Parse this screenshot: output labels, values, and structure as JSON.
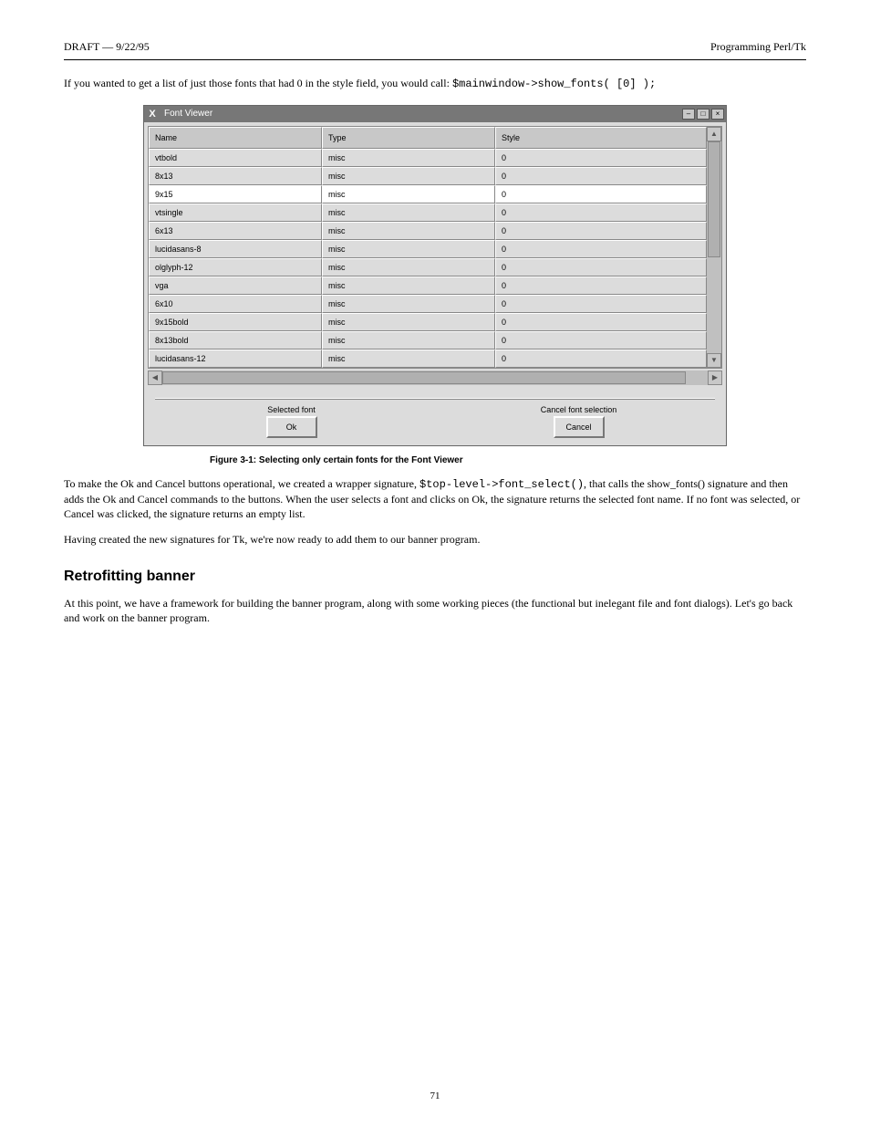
{
  "header": {
    "left": "DRAFT — 9/22/95",
    "right": "Programming Perl/Tk"
  },
  "intro": "If you wanted to get a list of just those fonts that had 0 in the style field, you would call:",
  "intro_code": "$mainwindow->show_fonts( [0] );",
  "window": {
    "title": "Font Viewer",
    "columns": [
      "Name",
      "Type",
      "Style"
    ],
    "rows": [
      {
        "name": "vtbold",
        "type": "misc",
        "style": "0",
        "selected": false
      },
      {
        "name": "8x13",
        "type": "misc",
        "style": "0",
        "selected": false
      },
      {
        "name": "9x15",
        "type": "misc",
        "style": "0",
        "selected": true
      },
      {
        "name": "vtsingle",
        "type": "misc",
        "style": "0",
        "selected": false
      },
      {
        "name": "6x13",
        "type": "misc",
        "style": "0",
        "selected": false
      },
      {
        "name": "lucidasans-8",
        "type": "misc",
        "style": "0",
        "selected": false
      },
      {
        "name": "olglyph-12",
        "type": "misc",
        "style": "0",
        "selected": false
      },
      {
        "name": "vga",
        "type": "misc",
        "style": "0",
        "selected": false
      },
      {
        "name": "6x10",
        "type": "misc",
        "style": "0",
        "selected": false
      },
      {
        "name": "9x15bold",
        "type": "misc",
        "style": "0",
        "selected": false
      },
      {
        "name": "8x13bold",
        "type": "misc",
        "style": "0",
        "selected": false
      },
      {
        "name": "lucidasans-12",
        "type": "misc",
        "style": "0",
        "selected": false
      }
    ],
    "selected_caption": "Selected font",
    "ok_label": "Ok",
    "cancel_caption": "Cancel font selection",
    "cancel_label": "Cancel"
  },
  "figure_caption": "Figure 3-1: Selecting only certain fonts for the Font Viewer",
  "p1_a": "To make the Ok and Cancel buttons operational, we created a wrapper signature, ",
  "p1_code": "$top-level->font_select()",
  "p1_b": ", that calls the show_fonts() signature and then adds the Ok and Cancel commands to the buttons. When the user selects a font and clicks on Ok, the signature returns the selected font name. If no font was selected, or Cancel was clicked, the signature returns an empty list.",
  "p2": "Having created the new signatures for Tk, we're now ready to add them to our banner program.",
  "section": "Retrofitting banner",
  "p3": "At this point, we have a framework for building the banner program, along with some working pieces (the functional but inelegant file and font dialogs). Let's go back and work on the banner program.",
  "footer": "71"
}
